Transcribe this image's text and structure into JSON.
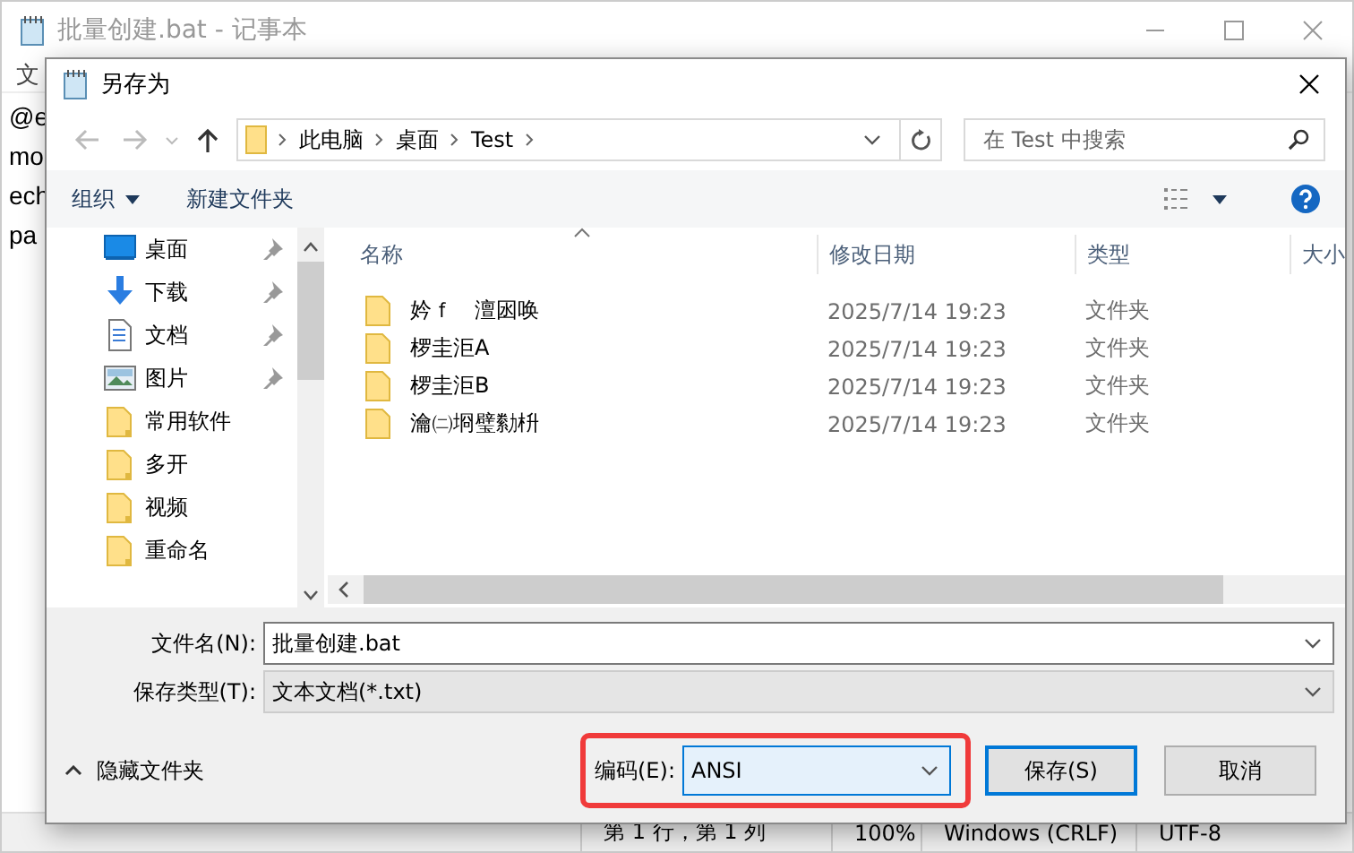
{
  "notepad": {
    "title": "批量创建.bat - 记事本",
    "active": false,
    "menu": [
      "文"
    ],
    "lines": [
      "@e",
      "mo",
      "ech",
      "pa"
    ],
    "status_bar": [
      "第 1 行，第 1 列",
      "100%",
      "Windows (CRLF)",
      "UTF-8"
    ]
  },
  "dialog": {
    "title": "另存为",
    "nav": {
      "back_disabled": true,
      "forward_disabled": true,
      "path": [
        "此电脑",
        "桌面",
        "Test"
      ]
    },
    "search": {
      "placeholder": "在 Test 中搜索"
    },
    "toolbar": {
      "organize": "组织",
      "new_folder": "新建文件夹"
    },
    "sidebar": {
      "items": [
        {
          "label": "桌面",
          "kind": "desktop",
          "pinned": true
        },
        {
          "label": "下载",
          "kind": "download",
          "pinned": true
        },
        {
          "label": "文档",
          "kind": "document",
          "pinned": true
        },
        {
          "label": "图片",
          "kind": "pictures",
          "pinned": true
        },
        {
          "label": "常用软件",
          "kind": "folder",
          "pinned": false
        },
        {
          "label": "多开",
          "kind": "folder",
          "pinned": false
        },
        {
          "label": "视频",
          "kind": "folder",
          "pinned": false
        },
        {
          "label": "重命名",
          "kind": "folder",
          "pinned": false
        }
      ]
    },
    "columns": [
      "名称",
      "修改日期",
      "类型",
      "大小"
    ],
    "rows": [
      {
        "name": "妗ｆ　澶囦唤",
        "modified": "2025/7/14 19:23",
        "type": "文件夹"
      },
      {
        "name": "椤圭洰A",
        "modified": "2025/7/14 19:23",
        "type": "文件夹"
      },
      {
        "name": "椤圭洰B",
        "modified": "2025/7/14 19:23",
        "type": "文件夹"
      },
      {
        "name": "瀹㈡埛璧勬枡",
        "modified": "2025/7/14 19:23",
        "type": "文件夹"
      }
    ],
    "file_name": {
      "label": "文件名(N):",
      "value": "批量创建.bat"
    },
    "save_type": {
      "label": "保存类型(T):",
      "value": "文本文档(*.txt)"
    },
    "hide_folders": "隐藏文件夹",
    "encoding": {
      "label": "编码(E):",
      "value": "ANSI",
      "highlighted": true
    },
    "buttons": [
      {
        "label": "保存(S)",
        "default": true
      },
      {
        "label": "取消",
        "default": false
      }
    ]
  }
}
